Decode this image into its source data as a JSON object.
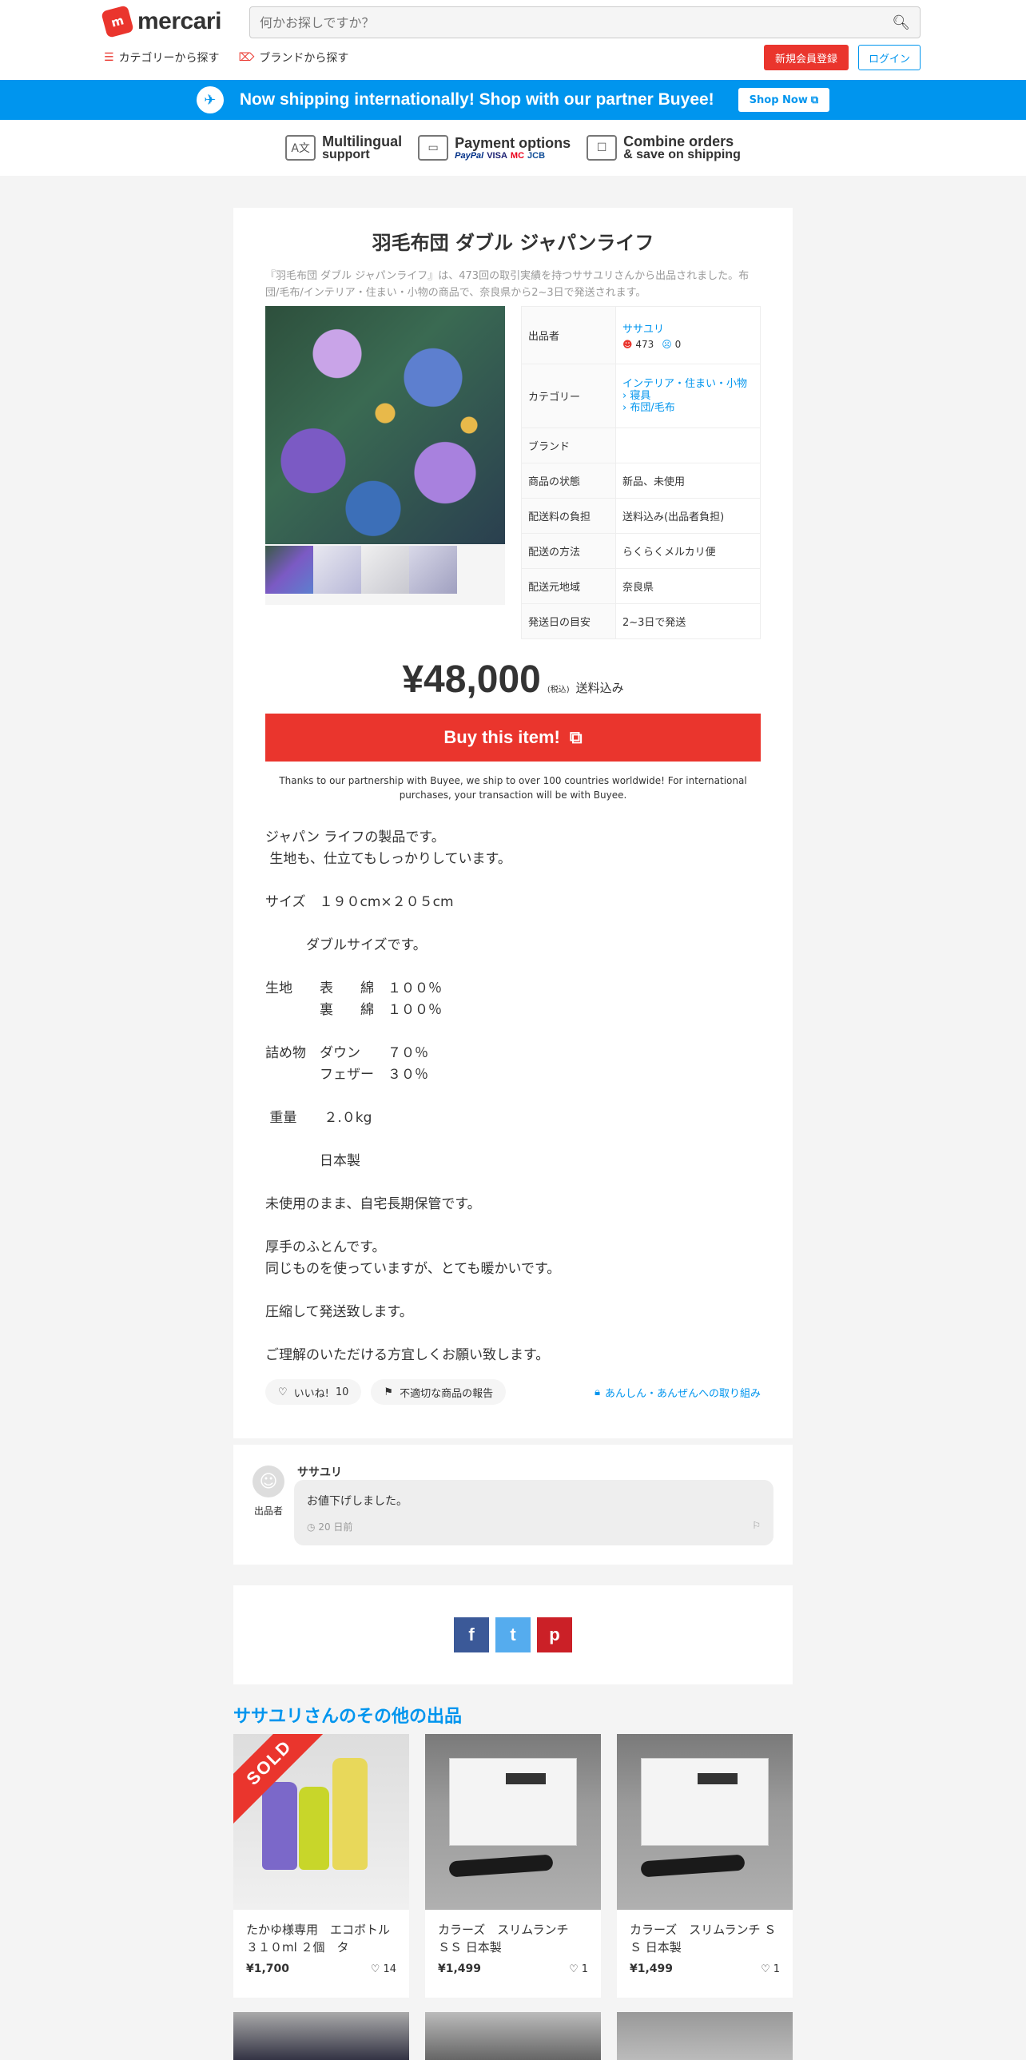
{
  "header": {
    "logo_mark": "m",
    "logo_text": "mercari",
    "search_placeholder": "何かお探しですか？",
    "nav_category": "カテゴリーから探す",
    "nav_brand": "ブランドから探す",
    "register_label": "新規会員登録",
    "login_label": "ログイン",
    "accent_color": "#ea352d",
    "link_color": "#0095ee"
  },
  "banner": {
    "text": "Now shipping internationally! Shop with our partner Buyee!",
    "button_label": "Shop Now"
  },
  "features": [
    {
      "title": "Multilingual",
      "sub": "support"
    },
    {
      "title": "Payment options",
      "logos": [
        "PayPal",
        "VISA",
        "MC",
        "JCB"
      ]
    },
    {
      "title": "Combine orders",
      "sub": "& save on shipping"
    }
  ],
  "item": {
    "title": "羽毛布団 ダブル ジャパンライフ",
    "summary": "『羽毛布団 ダブル ジャパンライフ』は、473回の取引実績を持つササユリさんから出品されました。布団/毛布/インテリア・住まい・小物の商品で、奈良県から2~3日で発送されます。",
    "details": {
      "seller_label": "出品者",
      "seller_name": "ササユリ",
      "rating_good": "473",
      "rating_bad": "0",
      "category_label": "カテゴリー",
      "category_main": "インテリア・住まい・小物",
      "category_sub1": "寝具",
      "category_sub2": "布団/毛布",
      "brand_label": "ブランド",
      "brand_value": "",
      "condition_label": "商品の状態",
      "condition_value": "新品、未使用",
      "shipping_fee_label": "配送料の負担",
      "shipping_fee_value": "送料込み(出品者負担)",
      "method_label": "配送の方法",
      "method_value": "らくらくメルカリ便",
      "origin_label": "配送元地域",
      "origin_value": "奈良県",
      "days_label": "発送日の目安",
      "days_value": "2~3日で発送"
    },
    "price": "¥48,000",
    "tax_note": "(税込)",
    "shipping_note": "送料込み",
    "buy_label": "Buy this item!",
    "buyee_note": "Thanks to our partnership with Buyee, we ship to over 100 countries worldwide! For international purchases, your transaction will be with Buyee.",
    "description": "ジャパン ライフの製品です。\n 生地も、仕立てもしっかりしています。\n\nサイズ　１９０cm×２０５cm\n\n　　　ダブルサイズです。\n\n生地　　表　　綿　１００％\n　　　　裏　　綿　１００％\n\n詰め物　ダウン　　７０％\n　　　　フェザー　３０％\n\n 重量　　２.０kg\n\n　　　　日本製\n\n未使用のまま、自宅長期保管です。\n\n厚手のふとんです。\n同じものを使っていますが、とても暖かいです。\n\n圧縮して発送致します。\n\nご理解のいただける方宜しくお願い致します。",
    "like_label": "いいね!",
    "like_count": "10",
    "report_label": "不適切な商品の報告",
    "safe_label": "あんしん・あんぜんへの取り組み"
  },
  "comment": {
    "name": "ササユリ",
    "role": "出品者",
    "text": "お値下げしました。",
    "time": "20 日前"
  },
  "share": [
    "f",
    "t",
    "p"
  ],
  "others": {
    "title": "ササユリさんのその他の出品",
    "sold_label": "SOLD",
    "items": [
      {
        "name": "たかゆ様専用　エコボトル　３１０ml ２個　タ",
        "price": "¥1,700",
        "likes": "14",
        "sold": true
      },
      {
        "name": "カラーズ　スリムランチ　ＳＳ 日本製",
        "price": "¥1,499",
        "likes": "1",
        "sold": false
      },
      {
        "name": "カラーズ　スリムランチ ＳＳ 日本製",
        "price": "¥1,499",
        "likes": "1",
        "sold": false
      }
    ]
  }
}
